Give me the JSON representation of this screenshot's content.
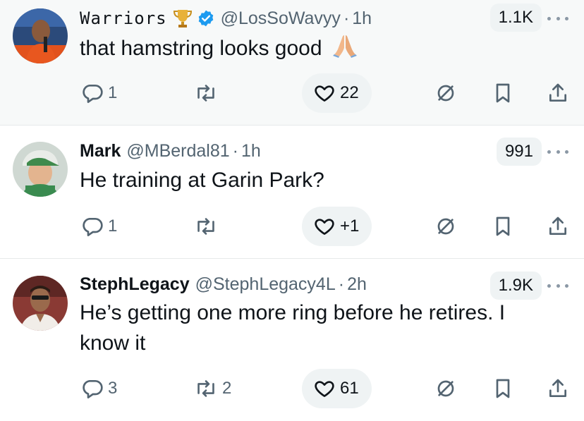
{
  "tweets": [
    {
      "name": "Warriors",
      "name_emoji": "🏆",
      "verified": true,
      "handle": "@LosSoWavyy",
      "time": "1h",
      "views": "1.1K",
      "text": "that hamstring looks good",
      "text_emoji": "🙏",
      "replies": "1",
      "reposts": "",
      "likes": "22",
      "avatar_icon": "avatar-photo"
    },
    {
      "name": "Mark",
      "handle": "@MBerdal81",
      "time": "1h",
      "views": "991",
      "text": "He training at Garin Park?",
      "replies": "1",
      "reposts": "",
      "likes": "+1",
      "avatar_icon": "avatar-photo"
    },
    {
      "name": "StephLegacy",
      "handle": "@StephLegacy4L",
      "time": "2h",
      "views": "1.9K",
      "text": "He’s getting one more ring before he retires. I know it",
      "replies": "3",
      "reposts": "2",
      "likes": "61",
      "avatar_icon": "avatar-photo"
    }
  ],
  "separator": "·",
  "colors": {
    "text": "#0f1419",
    "muted": "#536471",
    "verified": "#1d9bf0",
    "pill": "#eff3f4",
    "highlight_bg": "#f7f9f9"
  }
}
